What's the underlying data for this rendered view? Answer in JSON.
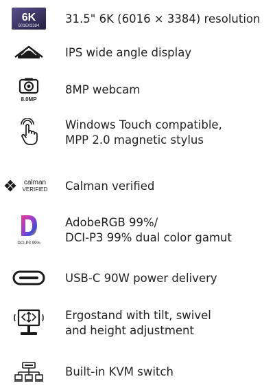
{
  "features": [
    {
      "lines": [
        "31.5\" 6K (6016 × 3384) resolution"
      ],
      "icon": "6k-resolution-icon",
      "icon_text": {
        "big": "6K",
        "small": "6016X3384"
      }
    },
    {
      "lines": [
        "IPS wide angle display"
      ],
      "icon": "wide-angle-display-icon"
    },
    {
      "lines": [
        "8MP webcam"
      ],
      "icon": "webcam-icon",
      "icon_text": {
        "label": "8.0MP"
      }
    },
    {
      "lines": [
        "Windows Touch compatible,",
        "MPP 2.0 magnetic stylus"
      ],
      "icon": "touch-hand-icon"
    },
    {
      "lines": [
        "Calman verified"
      ],
      "icon": "calman-verified-logo",
      "icon_text": {
        "top": "calman",
        "bottom": "VERIFIED"
      }
    },
    {
      "lines": [
        "AdobeRGB 99%/",
        "DCI-P3 99% dual color gamut"
      ],
      "icon": "color-gamut-icon",
      "icon_text": {
        "letter": "D",
        "caption": "DCI-P3 99%"
      }
    },
    {
      "lines": [
        "USB-C 90W power delivery"
      ],
      "icon": "usb-c-icon"
    },
    {
      "lines": [
        "Ergostand with tilt, swivel",
        "and height adjustment"
      ],
      "icon": "ergostand-icon"
    },
    {
      "lines": [
        "Built-in KVM switch"
      ],
      "icon": "kvm-switch-icon"
    }
  ],
  "colors": {
    "text": "#222222",
    "icon_dark": "#1a1a1a",
    "badge_bg": "#3c3560",
    "gamut_gradient": [
      "#e83b8c",
      "#9b3fd1",
      "#3f4fd6",
      "#f6a21c"
    ]
  }
}
